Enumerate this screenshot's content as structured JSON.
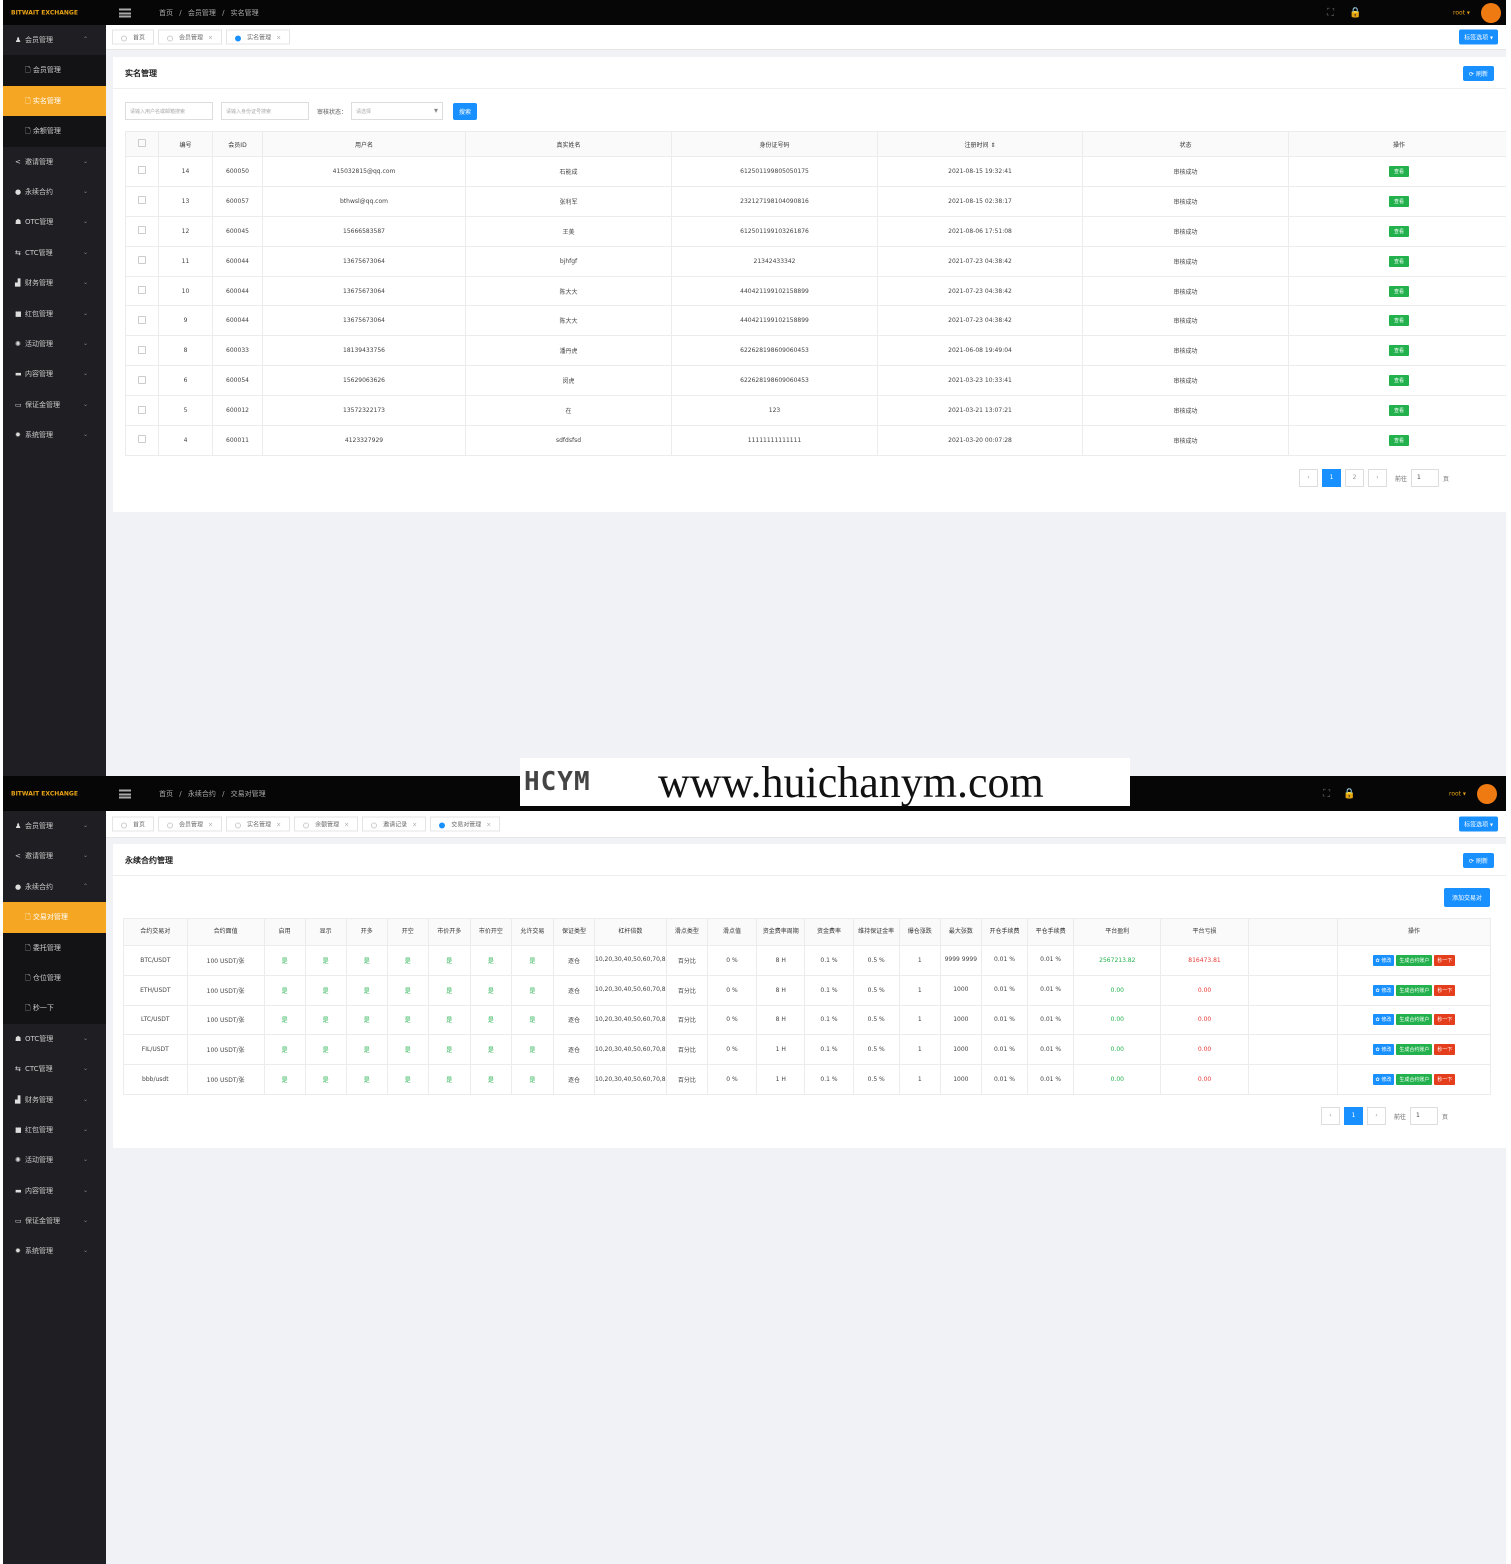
{
  "brand": "BITWAIT EXCHANGE",
  "user": "root ▾",
  "tab_options_label": "标签选项 ▾",
  "refresh_label": "刷新",
  "icons": {
    "fullscreen": "⛶",
    "lock": "🔒"
  },
  "watermark": {
    "logo": "HCYM",
    "url": "www.huichanym.com"
  },
  "screen1": {
    "breadcrumb": [
      "首页",
      "/",
      "会员管理",
      "/",
      "实名管理"
    ],
    "sidebar": [
      {
        "label": "会员管理",
        "icon": "user-icon",
        "glyph": "♟",
        "arrow": "⌃",
        "type": "group"
      },
      {
        "label": "会员管理",
        "type": "sub"
      },
      {
        "label": "实名管理",
        "type": "sub",
        "active": true
      },
      {
        "label": "余额管理",
        "type": "sub"
      },
      {
        "label": "邀请管理",
        "icon": "share-icon",
        "glyph": "<",
        "arrow": "⌄",
        "type": "group"
      },
      {
        "label": "永续合约",
        "icon": "circle-icon",
        "glyph": "●",
        "arrow": "⌄",
        "type": "group"
      },
      {
        "label": "OTC管理",
        "icon": "home-icon",
        "glyph": "☗",
        "arrow": "⌄",
        "type": "group"
      },
      {
        "label": "CTC管理",
        "icon": "exchange-icon",
        "glyph": "⇆",
        "arrow": "⌄",
        "type": "group"
      },
      {
        "label": "财务管理",
        "icon": "chart-icon",
        "glyph": "▟",
        "arrow": "⌄",
        "type": "group"
      },
      {
        "label": "红包管理",
        "icon": "gift-icon",
        "glyph": "■",
        "arrow": "⌄",
        "type": "group"
      },
      {
        "label": "活动管理",
        "icon": "gear-icon",
        "glyph": "✺",
        "arrow": "⌄",
        "type": "group"
      },
      {
        "label": "内容管理",
        "icon": "doc-icon",
        "glyph": "▬",
        "arrow": "⌄",
        "type": "group"
      },
      {
        "label": "保证金管理",
        "icon": "card-icon",
        "glyph": "▭",
        "arrow": "⌄",
        "type": "group"
      },
      {
        "label": "系统管理",
        "icon": "settings-icon",
        "glyph": "✹",
        "arrow": "⌄",
        "type": "group"
      }
    ],
    "tabs": [
      {
        "label": "首页",
        "closable": false,
        "active": false
      },
      {
        "label": "会员管理",
        "closable": true,
        "active": false
      },
      {
        "label": "实名管理",
        "closable": true,
        "active": true
      }
    ],
    "page_title": "实名管理",
    "filters": {
      "user_placeholder": "请输入用户名或邮箱搜索",
      "id_placeholder": "请输入身份证号搜索",
      "status_label": "审核状态：",
      "status_placeholder": "请选择",
      "search_label": "搜索"
    },
    "table": {
      "headers": [
        "",
        "编号",
        "会员ID",
        "用户名",
        "真实姓名",
        "身份证号码",
        "注册时间 ⇕",
        "状态",
        "操作"
      ],
      "rows": [
        [
          "14",
          "600050",
          "415032815@qq.com",
          "石能成",
          "612501199805050175",
          "2021-08-15 19:32:41",
          "审核成功",
          "查看"
        ],
        [
          "13",
          "600057",
          "bthwsl@qq.com",
          "张利军",
          "232127198104090816",
          "2021-08-15 02:38:17",
          "审核成功",
          "查看"
        ],
        [
          "12",
          "600045",
          "15666583587",
          "王美",
          "612501199103261876",
          "2021-08-06 17:51:08",
          "审核成功",
          "查看"
        ],
        [
          "11",
          "600044",
          "13675673064",
          "bjhfgf",
          "21342433342",
          "2021-07-23 04:38:42",
          "审核成功",
          "查看"
        ],
        [
          "10",
          "600044",
          "13675673064",
          "陈大大",
          "440421199102158899",
          "2021-07-23 04:38:42",
          "审核成功",
          "查看"
        ],
        [
          "9",
          "600044",
          "13675673064",
          "陈大大",
          "440421199102158899",
          "2021-07-23 04:38:42",
          "审核成功",
          "查看"
        ],
        [
          "8",
          "600033",
          "18139433756",
          "潘丹虎",
          "622628198609060453",
          "2021-06-08 19:49:04",
          "审核成功",
          "查看"
        ],
        [
          "6",
          "600054",
          "15629063626",
          "闵虎",
          "622628198609060453",
          "2021-03-23 10:33:41",
          "审核成功",
          "查看"
        ],
        [
          "5",
          "600012",
          "13572322173",
          "在",
          "123",
          "2021-03-21 13:07:21",
          "审核成功",
          "查看"
        ],
        [
          "4",
          "600011",
          "4123327929",
          "sdfdsfsd",
          "11111111111111",
          "2021-03-20 00:07:28",
          "审核成功",
          "查看"
        ]
      ]
    },
    "pagination": {
      "prev": "‹",
      "pages": [
        "1",
        "2"
      ],
      "next": "›",
      "goto_label": "前往",
      "goto_value": "1",
      "page_unit": "页"
    }
  },
  "screen2": {
    "breadcrumb": [
      "首页",
      "/",
      "永续合约",
      "/",
      "交易对管理"
    ],
    "sidebar": [
      {
        "label": "会员管理",
        "icon": "user-icon",
        "glyph": "♟",
        "arrow": "⌄",
        "type": "group"
      },
      {
        "label": "邀请管理",
        "icon": "share-icon",
        "glyph": "<",
        "arrow": "⌄",
        "type": "group"
      },
      {
        "label": "永续合约",
        "icon": "circle-icon",
        "glyph": "●",
        "arrow": "⌃",
        "type": "group"
      },
      {
        "label": "交易对管理",
        "type": "sub",
        "active": true
      },
      {
        "label": "委托管理",
        "type": "sub"
      },
      {
        "label": "仓位管理",
        "type": "sub"
      },
      {
        "label": "秒一下",
        "type": "sub"
      },
      {
        "label": "OTC管理",
        "icon": "home-icon",
        "glyph": "☗",
        "arrow": "⌄",
        "type": "group"
      },
      {
        "label": "CTC管理",
        "icon": "exchange-icon",
        "glyph": "⇆",
        "arrow": "⌄",
        "type": "group"
      },
      {
        "label": "财务管理",
        "icon": "chart-icon",
        "glyph": "▟",
        "arrow": "⌄",
        "type": "group"
      },
      {
        "label": "红包管理",
        "icon": "gift-icon",
        "glyph": "■",
        "arrow": "⌄",
        "type": "group"
      },
      {
        "label": "活动管理",
        "icon": "gear-icon",
        "glyph": "✺",
        "arrow": "⌄",
        "type": "group"
      },
      {
        "label": "内容管理",
        "icon": "doc-icon",
        "glyph": "▬",
        "arrow": "⌄",
        "type": "group"
      },
      {
        "label": "保证金管理",
        "icon": "card-icon",
        "glyph": "▭",
        "arrow": "⌄",
        "type": "group"
      },
      {
        "label": "系统管理",
        "icon": "settings-icon",
        "glyph": "✹",
        "arrow": "⌄",
        "type": "group"
      }
    ],
    "tabs": [
      {
        "label": "首页",
        "closable": false,
        "active": false
      },
      {
        "label": "会员管理",
        "closable": true,
        "active": false
      },
      {
        "label": "实名管理",
        "closable": true,
        "active": false
      },
      {
        "label": "余额管理",
        "closable": true,
        "active": false
      },
      {
        "label": "邀请记录",
        "closable": true,
        "active": false
      },
      {
        "label": "交易对管理",
        "closable": true,
        "active": true
      }
    ],
    "page_title": "永续合约管理",
    "add_label": "添加交易对",
    "table": {
      "headers": [
        "合约交易对",
        "合约面值",
        "启用",
        "显示",
        "开多",
        "开空",
        "市价开多",
        "市价开空",
        "允许交易",
        "保证类型",
        "杠杆倍数",
        "滑点类型",
        "滑点值",
        "资金费率周期",
        "资金费率",
        "维持保证金率",
        "爆仓涨跌",
        "最大张数",
        "开仓手续费",
        "平仓手续费",
        "平台盈利",
        "平台亏损",
        "",
        "操作"
      ],
      "rows": [
        [
          "BTC/USDT",
          "100 USDT/张",
          "是",
          "是",
          "是",
          "是",
          "是",
          "是",
          "是",
          "逐仓",
          "10,20,30,40,50,60,70,80,90,100",
          "百分比",
          "0 %",
          "8 H",
          "0.1 %",
          "0.5 %",
          "1",
          "9999 9999",
          "0.01 %",
          "0.01 %",
          "2567213.82",
          "816473.81"
        ],
        [
          "ETH/USDT",
          "100 USDT/张",
          "是",
          "是",
          "是",
          "是",
          "是",
          "是",
          "是",
          "逐仓",
          "10,20,30,40,50,60,70,80,90,100",
          "百分比",
          "0 %",
          "8 H",
          "0.1 %",
          "0.5 %",
          "1",
          "1000",
          "0.01 %",
          "0.01 %",
          "0.00",
          "0.00"
        ],
        [
          "LTC/USDT",
          "100 USDT/张",
          "是",
          "是",
          "是",
          "是",
          "是",
          "是",
          "是",
          "逐仓",
          "10,20,30,40,50,60,70,80,90,100",
          "百分比",
          "0 %",
          "8 H",
          "0.1 %",
          "0.5 %",
          "1",
          "1000",
          "0.01 %",
          "0.01 %",
          "0.00",
          "0.00"
        ],
        [
          "FIL/USDT",
          "100 USDT/张",
          "是",
          "是",
          "是",
          "是",
          "是",
          "是",
          "是",
          "逐仓",
          "10,20,30,40,50,60,70,80,90,100",
          "百分比",
          "0 %",
          "1 H",
          "0.1 %",
          "0.5 %",
          "1",
          "1000",
          "0.01 %",
          "0.01 %",
          "0.00",
          "0.00"
        ],
        [
          "bbb/usdt",
          "100 USDT/张",
          "是",
          "是",
          "是",
          "是",
          "是",
          "是",
          "是",
          "逐仓",
          "10,20,30,40,50,60,70,80,90,100",
          "百分比",
          "0 %",
          "1 H",
          "0.1 %",
          "0.5 %",
          "1",
          "1000",
          "0.01 %",
          "0.01 %",
          "0.00",
          "0.00"
        ]
      ],
      "actions": {
        "edit": "✿ 修改",
        "gen": "生成合约账户",
        "down": "秒一下"
      }
    },
    "pagination": {
      "prev": "‹",
      "pages": [
        "1"
      ],
      "next": "›",
      "goto_label": "前往",
      "goto_value": "1",
      "page_unit": "页"
    }
  },
  "colors": {
    "accent": "#f5a623",
    "primary": "#1890ff",
    "success": "#22b14c",
    "danger": "#e53935",
    "sidebar": "#1f1f23",
    "topbar": "#060606"
  }
}
